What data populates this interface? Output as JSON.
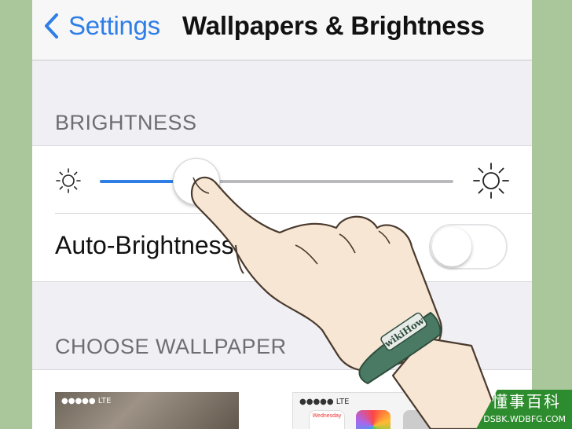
{
  "navbar": {
    "back_label": "Settings",
    "title": "Wallpapers & Brightness"
  },
  "brightness": {
    "section_title": "BRIGHTNESS",
    "level": 0.27,
    "auto_label": "Auto-Brightness",
    "auto_enabled": false
  },
  "wallpaper": {
    "section_title": "CHOOSE WALLPAPER",
    "lock_screen_status": "●●●●● LTE",
    "home_screen_status": "●●●●● LTE",
    "home_screen_app": "Wednesday"
  },
  "hand_band_text": "wikiHow",
  "watermark": {
    "brand": "懂事百科",
    "url": "DSBK.WDBFG.COM"
  },
  "colors": {
    "accent": "#2f7ee6",
    "background_outer": "#a9c79b",
    "band": "#4a7a63"
  },
  "icons": [
    "chevron-left-icon",
    "sun-small-icon",
    "sun-large-icon",
    "pointing-hand-icon"
  ]
}
